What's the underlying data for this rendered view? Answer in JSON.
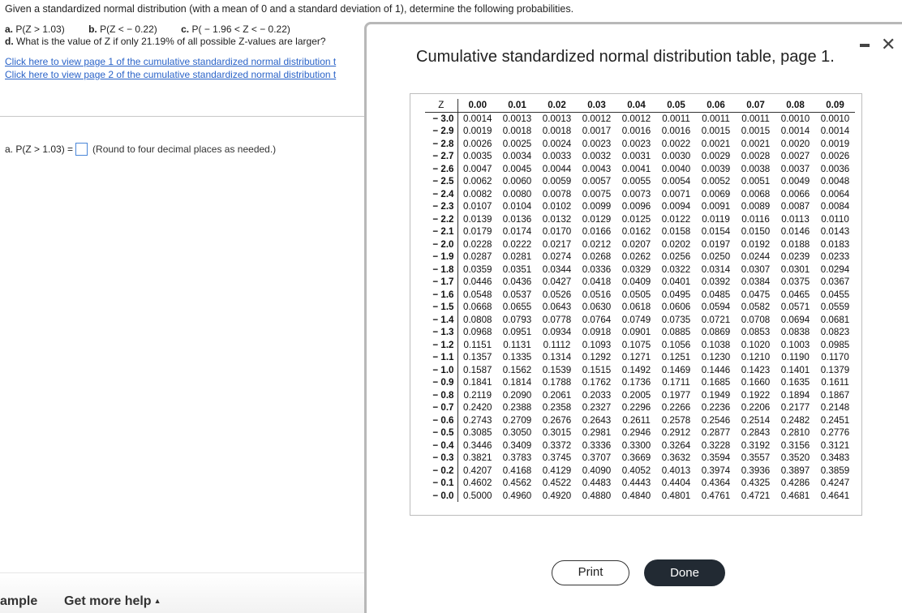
{
  "question": {
    "intro": "Given a standardized normal distribution (with a mean of 0 and a standard deviation of 1), determine the following probabilities.",
    "part_a_label": "a.",
    "part_a": "P(Z > 1.03)",
    "part_b_label": "b.",
    "part_b": "P(Z < − 0.22)",
    "part_c_label": "c.",
    "part_c": "P( − 1.96 < Z < − 0.22)",
    "part_d_label": "d.",
    "part_d": "What is the value of Z if only 21.19% of all possible Z-values are larger?",
    "link1": "Click here to view page 1 of the cumulative standardized normal distribution t",
    "link2": "Click here to view page 2 of the cumulative standardized normal distribution t",
    "answer_label": "a. P(Z > 1.03) =",
    "answer_value": "",
    "answer_hint": "(Round to four decimal places as needed.)"
  },
  "footer": {
    "example": "ample",
    "help": "Get more help"
  },
  "modal": {
    "title": "Cumulative standardized normal distribution table, page 1.",
    "print_label": "Print",
    "done_label": "Done"
  },
  "table": {
    "z_header": "Z",
    "col_headers": [
      "0.00",
      "0.01",
      "0.02",
      "0.03",
      "0.04",
      "0.05",
      "0.06",
      "0.07",
      "0.08",
      "0.09"
    ],
    "rows": [
      {
        "z": "− 3.0",
        "vals": [
          "0.0014",
          "0.0013",
          "0.0013",
          "0.0012",
          "0.0012",
          "0.0011",
          "0.0011",
          "0.0011",
          "0.0010",
          "0.0010"
        ]
      },
      {
        "z": "− 2.9",
        "vals": [
          "0.0019",
          "0.0018",
          "0.0018",
          "0.0017",
          "0.0016",
          "0.0016",
          "0.0015",
          "0.0015",
          "0.0014",
          "0.0014"
        ]
      },
      {
        "z": "− 2.8",
        "vals": [
          "0.0026",
          "0.0025",
          "0.0024",
          "0.0023",
          "0.0023",
          "0.0022",
          "0.0021",
          "0.0021",
          "0.0020",
          "0.0019"
        ]
      },
      {
        "z": "− 2.7",
        "vals": [
          "0.0035",
          "0.0034",
          "0.0033",
          "0.0032",
          "0.0031",
          "0.0030",
          "0.0029",
          "0.0028",
          "0.0027",
          "0.0026"
        ]
      },
      {
        "z": "− 2.6",
        "vals": [
          "0.0047",
          "0.0045",
          "0.0044",
          "0.0043",
          "0.0041",
          "0.0040",
          "0.0039",
          "0.0038",
          "0.0037",
          "0.0036"
        ]
      },
      {
        "z": "− 2.5",
        "vals": [
          "0.0062",
          "0.0060",
          "0.0059",
          "0.0057",
          "0.0055",
          "0.0054",
          "0.0052",
          "0.0051",
          "0.0049",
          "0.0048"
        ]
      },
      {
        "z": "− 2.4",
        "vals": [
          "0.0082",
          "0.0080",
          "0.0078",
          "0.0075",
          "0.0073",
          "0.0071",
          "0.0069",
          "0.0068",
          "0.0066",
          "0.0064"
        ]
      },
      {
        "z": "− 2.3",
        "vals": [
          "0.0107",
          "0.0104",
          "0.0102",
          "0.0099",
          "0.0096",
          "0.0094",
          "0.0091",
          "0.0089",
          "0.0087",
          "0.0084"
        ]
      },
      {
        "z": "− 2.2",
        "vals": [
          "0.0139",
          "0.0136",
          "0.0132",
          "0.0129",
          "0.0125",
          "0.0122",
          "0.0119",
          "0.0116",
          "0.0113",
          "0.0110"
        ]
      },
      {
        "z": "− 2.1",
        "vals": [
          "0.0179",
          "0.0174",
          "0.0170",
          "0.0166",
          "0.0162",
          "0.0158",
          "0.0154",
          "0.0150",
          "0.0146",
          "0.0143"
        ]
      },
      {
        "z": "− 2.0",
        "vals": [
          "0.0228",
          "0.0222",
          "0.0217",
          "0.0212",
          "0.0207",
          "0.0202",
          "0.0197",
          "0.0192",
          "0.0188",
          "0.0183"
        ]
      },
      {
        "z": "− 1.9",
        "vals": [
          "0.0287",
          "0.0281",
          "0.0274",
          "0.0268",
          "0.0262",
          "0.0256",
          "0.0250",
          "0.0244",
          "0.0239",
          "0.0233"
        ]
      },
      {
        "z": "− 1.8",
        "vals": [
          "0.0359",
          "0.0351",
          "0.0344",
          "0.0336",
          "0.0329",
          "0.0322",
          "0.0314",
          "0.0307",
          "0.0301",
          "0.0294"
        ]
      },
      {
        "z": "− 1.7",
        "vals": [
          "0.0446",
          "0.0436",
          "0.0427",
          "0.0418",
          "0.0409",
          "0.0401",
          "0.0392",
          "0.0384",
          "0.0375",
          "0.0367"
        ]
      },
      {
        "z": "− 1.6",
        "vals": [
          "0.0548",
          "0.0537",
          "0.0526",
          "0.0516",
          "0.0505",
          "0.0495",
          "0.0485",
          "0.0475",
          "0.0465",
          "0.0455"
        ]
      },
      {
        "z": "− 1.5",
        "vals": [
          "0.0668",
          "0.0655",
          "0.0643",
          "0.0630",
          "0.0618",
          "0.0606",
          "0.0594",
          "0.0582",
          "0.0571",
          "0.0559"
        ]
      },
      {
        "z": "− 1.4",
        "vals": [
          "0.0808",
          "0.0793",
          "0.0778",
          "0.0764",
          "0.0749",
          "0.0735",
          "0.0721",
          "0.0708",
          "0.0694",
          "0.0681"
        ]
      },
      {
        "z": "− 1.3",
        "vals": [
          "0.0968",
          "0.0951",
          "0.0934",
          "0.0918",
          "0.0901",
          "0.0885",
          "0.0869",
          "0.0853",
          "0.0838",
          "0.0823"
        ]
      },
      {
        "z": "− 1.2",
        "vals": [
          "0.1151",
          "0.1131",
          "0.1112",
          "0.1093",
          "0.1075",
          "0.1056",
          "0.1038",
          "0.1020",
          "0.1003",
          "0.0985"
        ]
      },
      {
        "z": "− 1.1",
        "vals": [
          "0.1357",
          "0.1335",
          "0.1314",
          "0.1292",
          "0.1271",
          "0.1251",
          "0.1230",
          "0.1210",
          "0.1190",
          "0.1170"
        ]
      },
      {
        "z": "− 1.0",
        "vals": [
          "0.1587",
          "0.1562",
          "0.1539",
          "0.1515",
          "0.1492",
          "0.1469",
          "0.1446",
          "0.1423",
          "0.1401",
          "0.1379"
        ]
      },
      {
        "z": "− 0.9",
        "vals": [
          "0.1841",
          "0.1814",
          "0.1788",
          "0.1762",
          "0.1736",
          "0.1711",
          "0.1685",
          "0.1660",
          "0.1635",
          "0.1611"
        ]
      },
      {
        "z": "− 0.8",
        "vals": [
          "0.2119",
          "0.2090",
          "0.2061",
          "0.2033",
          "0.2005",
          "0.1977",
          "0.1949",
          "0.1922",
          "0.1894",
          "0.1867"
        ]
      },
      {
        "z": "− 0.7",
        "vals": [
          "0.2420",
          "0.2388",
          "0.2358",
          "0.2327",
          "0.2296",
          "0.2266",
          "0.2236",
          "0.2206",
          "0.2177",
          "0.2148"
        ]
      },
      {
        "z": "− 0.6",
        "vals": [
          "0.2743",
          "0.2709",
          "0.2676",
          "0.2643",
          "0.2611",
          "0.2578",
          "0.2546",
          "0.2514",
          "0.2482",
          "0.2451"
        ]
      },
      {
        "z": "− 0.5",
        "vals": [
          "0.3085",
          "0.3050",
          "0.3015",
          "0.2981",
          "0.2946",
          "0.2912",
          "0.2877",
          "0.2843",
          "0.2810",
          "0.2776"
        ]
      },
      {
        "z": "− 0.4",
        "vals": [
          "0.3446",
          "0.3409",
          "0.3372",
          "0.3336",
          "0.3300",
          "0.3264",
          "0.3228",
          "0.3192",
          "0.3156",
          "0.3121"
        ]
      },
      {
        "z": "− 0.3",
        "vals": [
          "0.3821",
          "0.3783",
          "0.3745",
          "0.3707",
          "0.3669",
          "0.3632",
          "0.3594",
          "0.3557",
          "0.3520",
          "0.3483"
        ]
      },
      {
        "z": "− 0.2",
        "vals": [
          "0.4207",
          "0.4168",
          "0.4129",
          "0.4090",
          "0.4052",
          "0.4013",
          "0.3974",
          "0.3936",
          "0.3897",
          "0.3859"
        ]
      },
      {
        "z": "− 0.1",
        "vals": [
          "0.4602",
          "0.4562",
          "0.4522",
          "0.4483",
          "0.4443",
          "0.4404",
          "0.4364",
          "0.4325",
          "0.4286",
          "0.4247"
        ]
      },
      {
        "z": "− 0.0",
        "vals": [
          "0.5000",
          "0.4960",
          "0.4920",
          "0.4880",
          "0.4840",
          "0.4801",
          "0.4761",
          "0.4721",
          "0.4681",
          "0.4641"
        ]
      }
    ]
  }
}
